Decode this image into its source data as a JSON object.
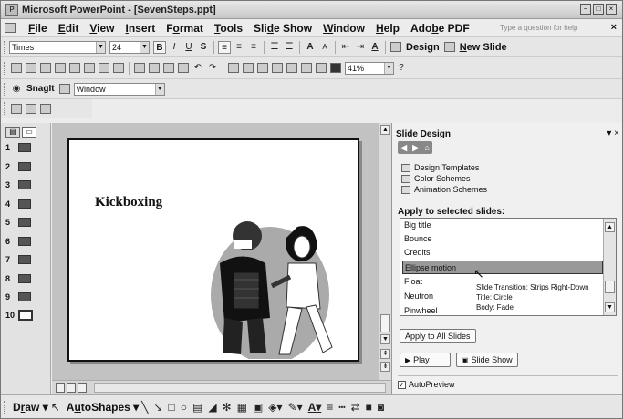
{
  "window": {
    "title": "Microsoft PowerPoint - [SevenSteps.ppt]",
    "app_icon": "powerpoint-icon",
    "controls": [
      "−",
      "□",
      "×"
    ]
  },
  "menubar": {
    "items": [
      {
        "pre": "",
        "u": "F",
        "post": "ile"
      },
      {
        "pre": "",
        "u": "E",
        "post": "dit"
      },
      {
        "pre": "",
        "u": "V",
        "post": "iew"
      },
      {
        "pre": "",
        "u": "I",
        "post": "nsert"
      },
      {
        "pre": "F",
        "u": "o",
        "post": "rmat"
      },
      {
        "pre": "",
        "u": "T",
        "post": "ools"
      },
      {
        "pre": "Sli",
        "u": "d",
        "post": "e Show"
      },
      {
        "pre": "",
        "u": "W",
        "post": "indow"
      },
      {
        "pre": "",
        "u": "H",
        "post": "elp"
      },
      {
        "pre": "Ado",
        "u": "b",
        "post": "e PDF"
      }
    ],
    "ask_placeholder": "Type a question for help",
    "close_glyph": "×"
  },
  "formatting_toolbar": {
    "font": "Times",
    "size": "24",
    "bold": "B",
    "italic": "I",
    "underline": "U",
    "shadow": "S",
    "grow_font": "A",
    "shrink_font": "A",
    "font_color": "A",
    "design_label": "Design",
    "new_slide_pre": "",
    "new_slide_u": "N",
    "new_slide_post": "ew Slide"
  },
  "standard_toolbar": {
    "zoom": "41%"
  },
  "snagit_toolbar": {
    "label": "SnagIt",
    "mode": "Window"
  },
  "slides": {
    "numbers": [
      "1",
      "2",
      "3",
      "4",
      "5",
      "6",
      "7",
      "8",
      "9",
      "10"
    ],
    "selected": "10",
    "slide_title": "Kickboxing"
  },
  "task_pane": {
    "title": "Slide Design",
    "nav_glyphs": [
      "◀",
      "▶",
      "⌂"
    ],
    "links": [
      "Design Templates",
      "Color Schemes",
      "Animation Schemes"
    ],
    "section_label": "Apply to selected slides:",
    "list_items": [
      "Big title",
      "Bounce",
      "Credits",
      "Ellipse motion",
      "Float",
      "Neutron",
      "Pinwheel"
    ],
    "selected_item": "Ellipse motion",
    "tooltip": {
      "line1": "Slide Transition: Strips Right-Down",
      "line2": "Title: Circle",
      "line3": "Body: Fade"
    },
    "apply_all": "Apply to All Slides",
    "play": "Play",
    "slide_show": "Slide Show",
    "autopreview": "AutoPreview",
    "autopreview_checked": "✓"
  },
  "drawing_toolbar": {
    "draw_pre": "D",
    "draw_u": "r",
    "draw_post": "aw",
    "autoshapes_pre": "A",
    "autoshapes_u": "u",
    "autoshapes_post": "toShapes"
  },
  "colors": {
    "chrome": "#ececec",
    "selection": "#999999"
  }
}
